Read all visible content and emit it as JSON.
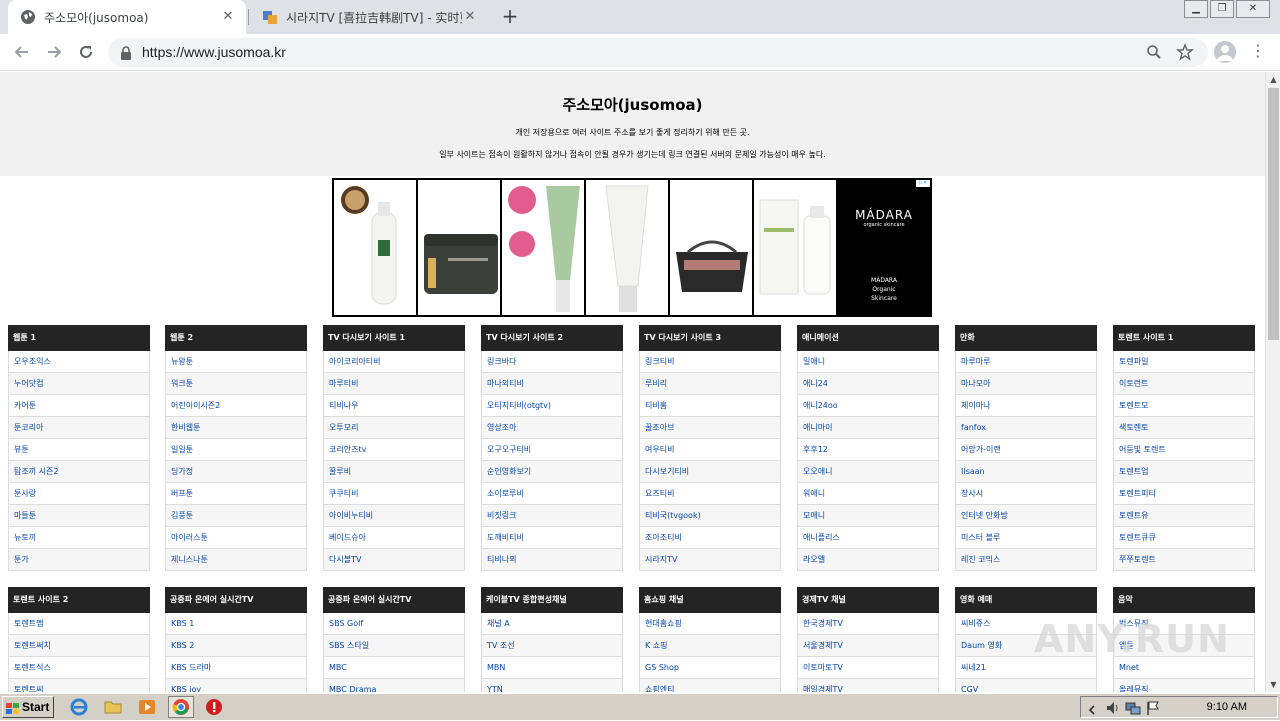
{
  "browser": {
    "tabs": [
      {
        "title": "주소모아(jusomoa)",
        "active": true
      },
      {
        "title": "시라지TV [喜拉吉韩剧TV] - 实时更新",
        "active": false
      }
    ],
    "url": "https://www.jusomoa.kr"
  },
  "page": {
    "title": "주소모아(jusomoa)",
    "desc1": "개인 저장용으로 여러 사이트 주소를 보기 좋게 정리하기 위해 만든 곳.",
    "desc2": "일부 사이트는 접속이 원활하지 않거나 접속이 안될 경우가 생기는데 링크 연결된 서버의 문제일 가능성이 매우 높다."
  },
  "ad": {
    "brand": "MÁDARA",
    "brand_sub": "organic skincare",
    "tagline": [
      "MÁDARA",
      "Organic",
      "Skincare"
    ],
    "products": [
      "cream-bottle",
      "feed-jar",
      "peel-tube",
      "scrub-tube",
      "whatever-bag",
      "serum-box"
    ]
  },
  "columns_row1": [
    {
      "header": "웹툰 1",
      "items": [
        "오우조익스",
        "누어닷컴",
        "카어툰",
        "툰코리아",
        "뷰툰",
        "탐조끼 시즌2",
        "툰사랑",
        "마들툰",
        "뉴토끼",
        "툰가"
      ]
    },
    {
      "header": "웹툰 2",
      "items": [
        "뉴왕툰",
        "워크툰",
        "어린이이시즌2",
        "한비웹툰",
        "일일툰",
        "딩가정",
        "버프툰",
        "김풍툰",
        "아이러스툰",
        "제니스나툰"
      ]
    },
    {
      "header": "TV 다시보기 사이트 1",
      "items": [
        "아이코리아티비",
        "마루티비",
        "티비나우",
        "오투모리",
        "코리안즈tv",
        "꿀루비",
        "쿠쿠티비",
        "아이비누티비",
        "베이드슈아",
        "다시볼TV"
      ]
    },
    {
      "header": "TV 다시보기 사이트 2",
      "items": [
        "링크바다",
        "마나외티비",
        "오티지티비(otgtv)",
        "영상조아",
        "오구오구티비",
        "순인영화보기",
        "소이로루비",
        "비짓링크",
        "도깨비티비",
        "티비나외"
      ]
    },
    {
      "header": "TV 다시보기 사이트 3",
      "items": [
        "링크티비",
        "루비리",
        "티비홈",
        "꿀조아브",
        "여우티비",
        "다시보기티비",
        "요즈티비",
        "티비국(tvgook)",
        "조아조티비",
        "시라지TV"
      ]
    },
    {
      "header": "애니메이션",
      "items": [
        "밀애니",
        "애니24",
        "애니24oo",
        "애니마이",
        "후후12",
        "오오애니",
        "워애니",
        "모애니",
        "애니플리스",
        "라오앨"
      ]
    },
    {
      "header": "만화",
      "items": [
        "마루마루",
        "마나모아",
        "제이마나",
        "fanfox",
        "어망가-이랜",
        "Ilsaan",
        "장사시",
        "인터넷 만화방",
        "미스터 블루",
        "레진 코믹스"
      ]
    },
    {
      "header": "토렌트 사이트 1",
      "items": [
        "토렌파일",
        "이토런트",
        "토렌트모",
        "색토렌토",
        "어둠빛 토렌트",
        "토렌트업",
        "토렌트피티",
        "토렌트유",
        "토렌트큐큐",
        "쭈쭈토렌트"
      ]
    }
  ],
  "columns_row2": [
    {
      "header": "토렌트 사이트 2",
      "items": [
        "토렌트맵",
        "토렌트써치",
        "토렌트식스",
        "토렌트씨"
      ]
    },
    {
      "header": "공중파 온에어 실시간TV",
      "items": [
        "KBS 1",
        "KBS 2",
        "KBS 드라마",
        "KBS joy"
      ]
    },
    {
      "header": "공중파 온에어 실시간TV",
      "items": [
        "SBS Golf",
        "SBS 스타일",
        "MBC",
        "MBC Drama"
      ]
    },
    {
      "header": "케이블TV 종합편성채널",
      "items": [
        "채널 A",
        "TV 조선",
        "MBN",
        "YTN"
      ]
    },
    {
      "header": "홈쇼핑 채널",
      "items": [
        "현대홈쇼핑",
        "K 쇼핑",
        "GS Shop",
        "쇼핑엔티"
      ]
    },
    {
      "header": "경제TV 채널",
      "items": [
        "한국경제TV",
        "서울경제TV",
        "이토마토TV",
        "매일경제TV"
      ]
    },
    {
      "header": "영화 예매",
      "items": [
        "씨비쥬스",
        "Daum 영화",
        "씨네21",
        "CGV"
      ]
    },
    {
      "header": "음악",
      "items": [
        "벅스뮤직",
        "엠듣",
        "Mnet",
        "올레뮤직"
      ]
    }
  ],
  "watermark": "ANY.RUN",
  "taskbar": {
    "start": "Start",
    "clock": "9:10 AM"
  }
}
